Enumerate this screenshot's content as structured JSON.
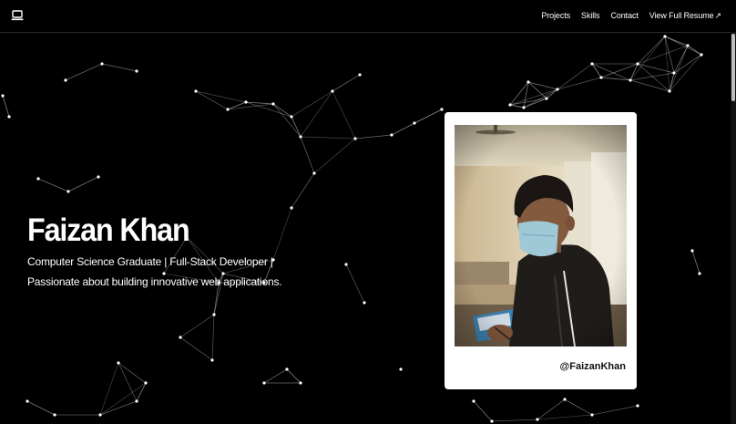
{
  "nav": {
    "logo_icon": "laptop-icon",
    "links": [
      "Projects",
      "Skills",
      "Contact"
    ],
    "resume_label": "View Full Resume",
    "resume_icon": "external-link-icon"
  },
  "hero": {
    "name": "Faizan Khan",
    "subtitle": "Computer Science Graduate | Full-Stack Developer | Passionate about building innovative web applications."
  },
  "profile": {
    "handle": "@FaizanKhan",
    "photo_subject": "person-wearing-mask-photo"
  },
  "colors": {
    "background": "#000000",
    "text": "#ffffff",
    "network_line": "#ffffff",
    "card": "#ffffff"
  }
}
